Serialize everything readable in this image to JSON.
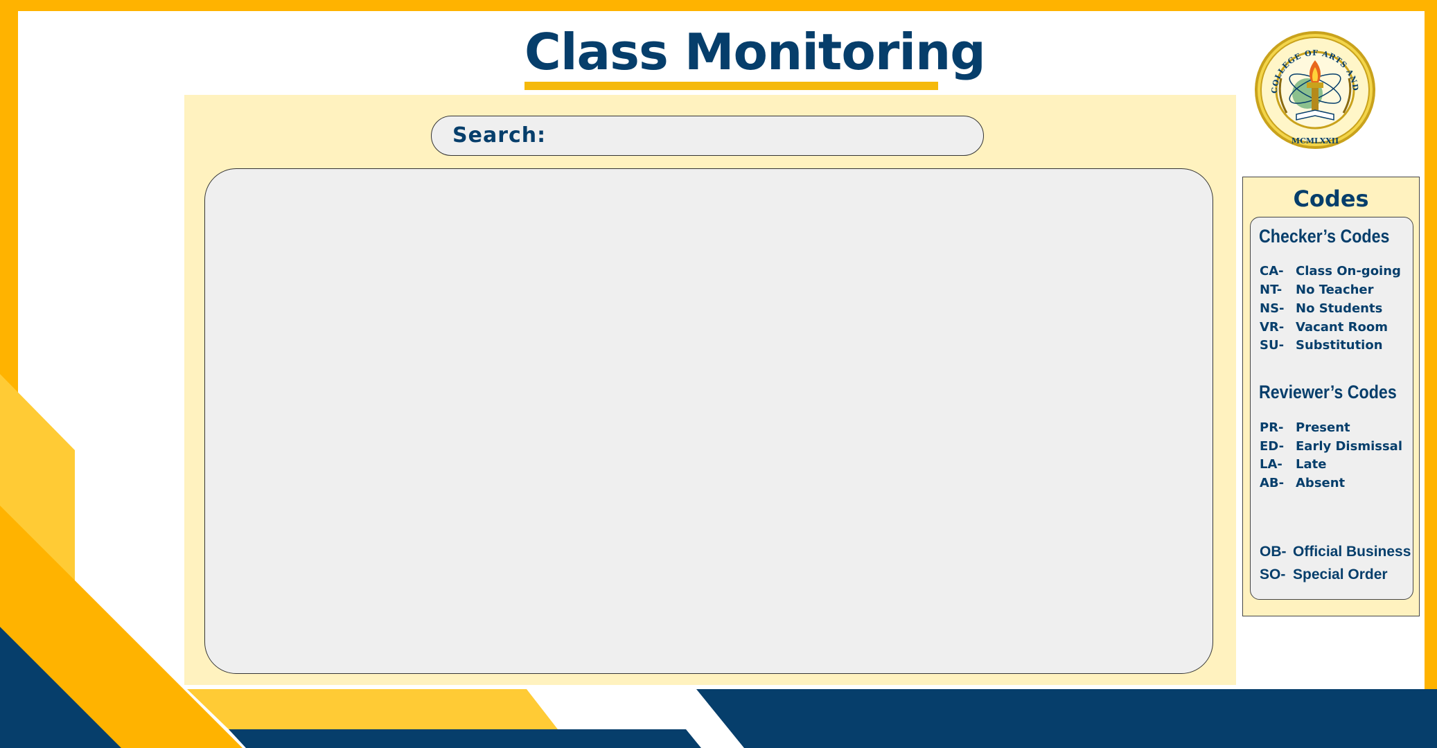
{
  "page": {
    "title": "Class Monitoring"
  },
  "search": {
    "label": "Search:",
    "value": "",
    "placeholder": ""
  },
  "codes_panel": {
    "title": "Codes",
    "checker": {
      "heading": "Checker’s Codes",
      "items": [
        {
          "code": "CA-",
          "label": "Class On-going"
        },
        {
          "code": "NT-",
          "label": "No Teacher"
        },
        {
          "code": "NS-",
          "label": "No Students"
        },
        {
          "code": "VR-",
          "label": "Vacant Room"
        },
        {
          "code": "SU-",
          "label": "Substitution"
        }
      ]
    },
    "reviewer": {
      "heading": "Reviewer’s Codes",
      "items": [
        {
          "code": "PR-",
          "label": "Present"
        },
        {
          "code": "ED-",
          "label": "Early Dismissal"
        },
        {
          "code": "LA-",
          "label": "Late"
        },
        {
          "code": "AB-",
          "label": "Absent"
        }
      ]
    },
    "other": {
      "items": [
        {
          "code": "OB-",
          "label": "Official Business"
        },
        {
          "code": "SO-",
          "label": "Special Order"
        }
      ]
    }
  },
  "logo": {
    "ring_text": "COLLEGE OF ARTS AND SCIENCES",
    "year_text": "MCMLXXII"
  },
  "colors": {
    "navy": "#063E6B",
    "gold": "#FFB300",
    "light_gold": "#FFCB35",
    "panel_cream": "#FFF2BF",
    "box_gray": "#EFEFEF"
  }
}
